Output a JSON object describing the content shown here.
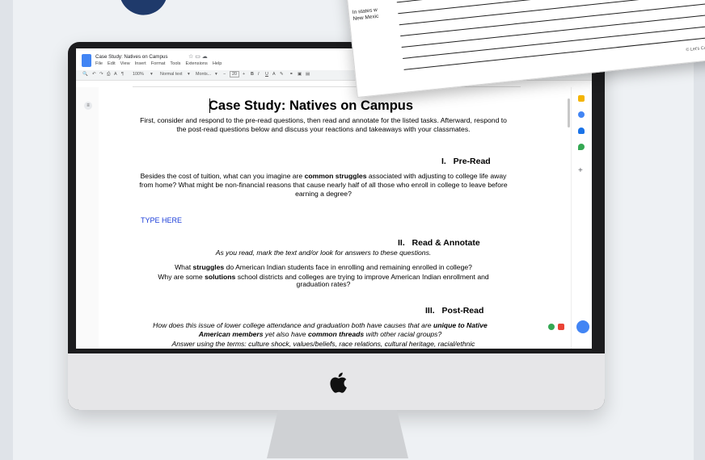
{
  "doc_window": {
    "title": "Case Study: Natives on Campus",
    "menu": [
      "File",
      "Edit",
      "View",
      "Insert",
      "Format",
      "Tools",
      "Extensions",
      "Help"
    ],
    "toolbar": {
      "zoom": "100%",
      "style": "Normal text",
      "font": "Monts...",
      "size": "20"
    }
  },
  "document": {
    "heading": "Case Study: Natives on Campus",
    "intro": "First, consider and respond to the pre-read questions, then read and annotate for the listed tasks. Afterward, respond to the post-read questions below and discuss your reactions and takeaways with your classmates.",
    "sections": [
      {
        "number": "I.",
        "title": "Pre-Read"
      },
      {
        "number": "II.",
        "title": "Read & Annotate"
      },
      {
        "number": "III.",
        "title": "Post-Read"
      }
    ],
    "pre_read_q_a": "Besides the cost of tuition, what can you imagine are ",
    "pre_read_bold": "common struggles",
    "pre_read_q_b": " associated with adjusting to college life away from home? What might be non-financial reasons that cause nearly half of all those who enroll in college to leave before earning a degree?",
    "type_here": "TYPE HERE",
    "annotate_instructions": "As you read, mark the text and/or look for answers to these questions.",
    "annotate_q1_a": "What ",
    "annotate_q1_bold": "struggles",
    "annotate_q1_b": " do American Indian students face in enrolling and remaining enrolled in college?",
    "annotate_q2_a": "Why are some ",
    "annotate_q2_bold": "solutions",
    "annotate_q2_b": " school districts and colleges are trying to improve American Indian enrollment and graduation rates?",
    "post_read_a": "How does this issue of lower college attendance and graduation both have causes that are ",
    "post_read_bold1": "unique to Native American members",
    "post_read_b": " yet also have ",
    "post_read_bold2": "common threads",
    "post_read_c": " with other racial groups?",
    "post_read_d": "Answer using the terms: culture shock, values/beliefs, race relations, cultural heritage, racial/ethnic"
  },
  "paper": {
    "line1": "In states w",
    "line2": "New Mexic",
    "copyright": "© Let's Cultivate Gre"
  }
}
